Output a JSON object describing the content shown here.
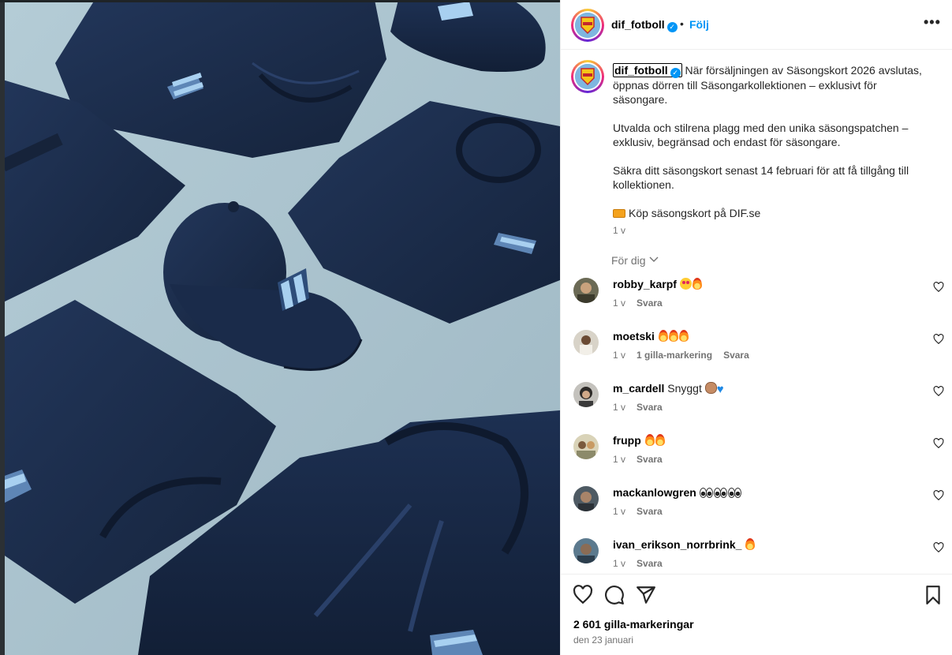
{
  "header": {
    "username": "dif_fotboll",
    "separator": "•",
    "follow_label": "Följ",
    "more_label": "•••"
  },
  "caption": {
    "username": "dif_fotboll",
    "paragraph1": "När försäljningen av Säsongskort 2026 avslutas, öppnas dörren till Säsongarkollektionen – exklusivt för säsongare.",
    "paragraph2": "Utvalda och stilrena plagg med den unika säsongspatchen – exklusiv, begränsad och endast för säsongare.",
    "paragraph3": "Säkra ditt säsongskort senast 14 februari för att få tillgång till kollektionen.",
    "paragraph4": "Köp säsongskort på DIF.se",
    "time": "1 v"
  },
  "sort_label": "För dig",
  "comments": [
    {
      "user": "robby_karpf",
      "text": "",
      "time": "1 v",
      "likes": "",
      "reply": "Svara"
    },
    {
      "user": "moetski",
      "text": "",
      "time": "1 v",
      "likes": "1 gilla-markering",
      "reply": "Svara"
    },
    {
      "user": "m_cardell",
      "text": "Snyggt",
      "time": "1 v",
      "likes": "",
      "reply": "Svara"
    },
    {
      "user": "frupp",
      "text": "",
      "time": "1 v",
      "likes": "",
      "reply": "Svara"
    },
    {
      "user": "mackanlowgren",
      "text": "",
      "time": "1 v",
      "likes": "",
      "reply": "Svara"
    },
    {
      "user": "ivan_erikson_norrbrink_",
      "text": "",
      "time": "1 v",
      "likes": "",
      "reply": "Svara"
    }
  ],
  "footer": {
    "likes": "2 601 gilla-markeringar",
    "date": "den 23 januari"
  },
  "colors": {
    "accent": "#0095f6",
    "muted": "#737373",
    "garment": "#1b2b45",
    "background": "#a9c1cb"
  },
  "icons": {
    "like": "heart-icon",
    "comment": "speech-bubble-icon",
    "share": "paper-plane-icon",
    "save": "bookmark-icon",
    "more": "ellipsis-icon",
    "verified": "verified-badge-icon"
  }
}
